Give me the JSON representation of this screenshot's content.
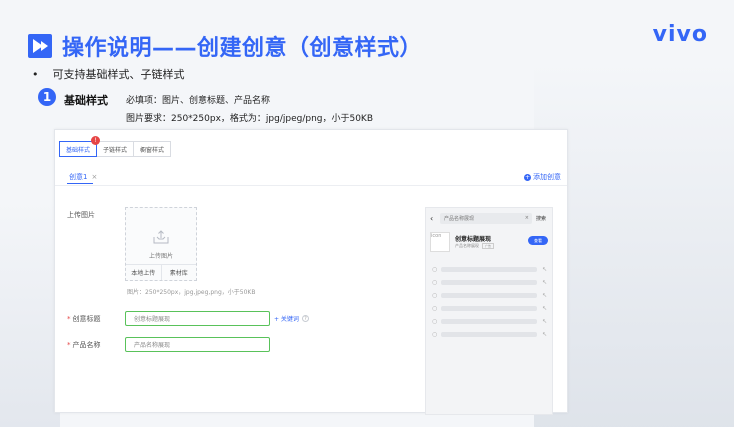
{
  "header": {
    "title": "操作说明——创建创意（创意样式）",
    "brand": "vivo"
  },
  "bullet": "可支持基础样式、子链样式",
  "step": {
    "number": "1",
    "title": "基础样式",
    "required": "必填项：图片、创意标题、产品名称",
    "image_req": "图片要求：250*250px，格式为：jpg/jpeg/png，小于50KB"
  },
  "panel": {
    "tabs": [
      {
        "label": "基础样式",
        "active": true,
        "badge": "!"
      },
      {
        "label": "子链样式",
        "active": false
      },
      {
        "label": "橱窗样式",
        "active": false
      }
    ],
    "creative_tab": "创意1",
    "creative_close": "×",
    "add_creative": "添加创意",
    "upload_label": "上传图片",
    "upload_text": "上传图片",
    "upload_local": "本地上传",
    "upload_library": "素材库",
    "upload_hint": "图片：250*250px，jpg,jpeg,png，小于50KB",
    "title_label": "创意标题",
    "title_value": "创意标题展现",
    "keyword_link": "+ 关键词",
    "product_label": "产品名称",
    "product_value": "产品名称展现",
    "required_mark": "*"
  },
  "preview": {
    "back": "‹",
    "search_text": "产品名称展现",
    "search_clear": "×",
    "search_button": "搜索",
    "img_alt": "icon",
    "card_title": "创意标题展现",
    "card_sub": "产品名称展现",
    "card_ad": "广告",
    "card_button": "查看",
    "rows": 6
  },
  "colors": {
    "accent": "#3466f6",
    "valid_border": "#59c25a",
    "badge": "#e64545"
  }
}
